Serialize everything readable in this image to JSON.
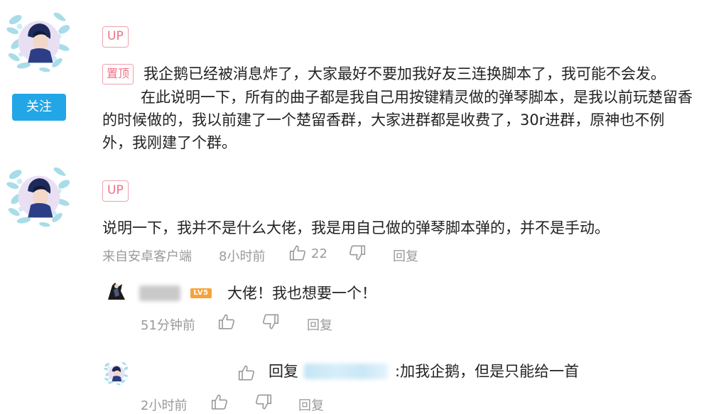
{
  "first_comment": {
    "up_label": "UP",
    "pin_label": "置顶",
    "lines": [
      "我企鹅已经被消息炸了，大家最好不要加我好友三连换脚本了，我可能不会发。",
      "在此说明一下，所有的曲子都是我自己用按键精灵做的弹琴脚本，是我以前玩楚留香",
      "的时候做的，我以前建了一个楚留香群，大家进群都是收费了，30r进群，原神也不例",
      "外，我刚建了个群。"
    ],
    "follow_label": "关注"
  },
  "second_comment": {
    "up_label": "UP",
    "text": "说明一下，我并不是什么大佬，我是用自己做的弹琴脚本弹的，并不是手动。",
    "source": "来自安卓客户端",
    "time": "8小时前",
    "like_count": "22",
    "reply_label": "回复"
  },
  "replies": [
    {
      "level": "LV5",
      "text": "大佬！我也想要一个！",
      "time": "51分钟前",
      "reply_label": "回复"
    },
    {
      "reply_prefix": "回复",
      "text": ":加我企鹅，但是只能给一首",
      "time": "2小时前",
      "reply_label": "回复"
    }
  ],
  "icons": {
    "like": "thumbs-up-icon",
    "dislike": "thumbs-down-icon"
  },
  "colors": {
    "follow_button": "#23a6e6",
    "badge_pink": "#f07086",
    "level_orange": "#f7a23b",
    "meta_gray": "#9a9a9a"
  }
}
